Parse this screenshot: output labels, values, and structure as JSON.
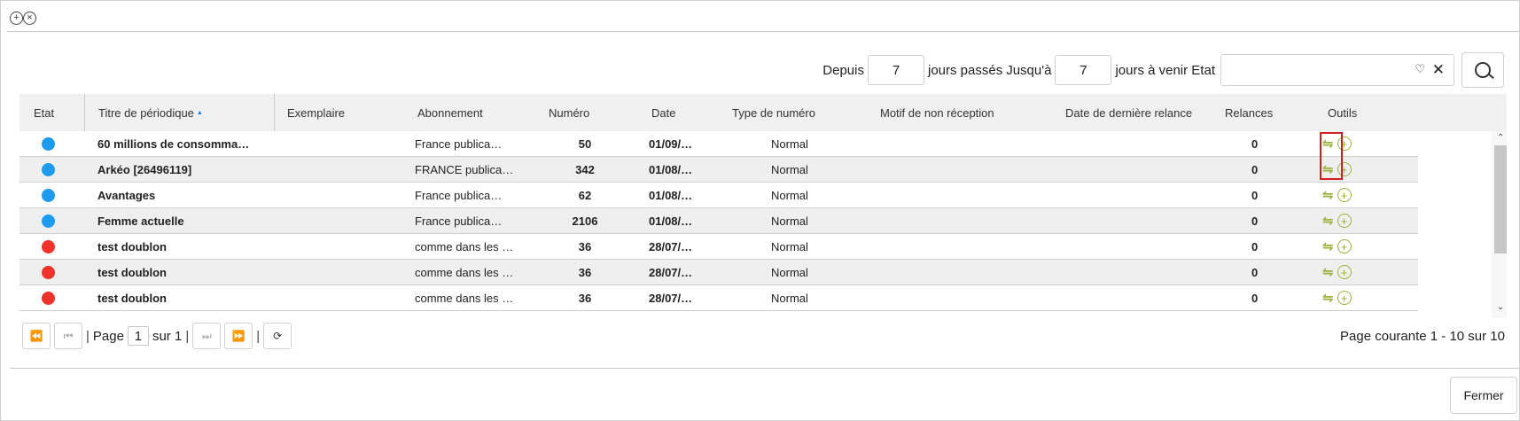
{
  "filters": {
    "since_label": "Depuis",
    "since_value": "7",
    "past_days_label": "jours passés",
    "until_label": "Jusqu'à",
    "until_value": "7",
    "future_days_label": "jours à venir Etat",
    "state_value": ""
  },
  "table": {
    "headers": {
      "etat": "Etat",
      "titre": "Titre de périodique",
      "exemplaire": "Exemplaire",
      "abonnement": "Abonnement",
      "numero": "Numéro",
      "date": "Date",
      "type": "Type de numéro",
      "motif": "Motif de non réception",
      "derniere_relance": "Date de dernière relance",
      "relances": "Relances",
      "outils": "Outils"
    },
    "rows": [
      {
        "color": "#1e9bef",
        "titre": "60 millions de consomma…",
        "abonnement": "France     publica…",
        "numero": "50",
        "date": "01/09/…",
        "type": "Normal",
        "relances": "0"
      },
      {
        "color": "#1e9bef",
        "titre": "Arkéo [26496119]",
        "abonnement": "FRANCE  publica…",
        "numero": "342",
        "date": "01/08/…",
        "type": "Normal",
        "relances": "0"
      },
      {
        "color": "#1e9bef",
        "titre": "Avantages",
        "abonnement": "France     publica…",
        "numero": "62",
        "date": "01/08/…",
        "type": "Normal",
        "relances": "0"
      },
      {
        "color": "#1e9bef",
        "titre": "Femme actuelle",
        "abonnement": "France     publica…",
        "numero": "2106",
        "date": "01/08/…",
        "type": "Normal",
        "relances": "0"
      },
      {
        "color": "#f0322a",
        "titre": "test doublon",
        "abonnement": "comme dans les …",
        "numero": "36",
        "date": "28/07/…",
        "type": "Normal",
        "relances": "0"
      },
      {
        "color": "#f0322a",
        "titre": "test doublon",
        "abonnement": "comme dans les …",
        "numero": "36",
        "date": "28/07/…",
        "type": "Normal",
        "relances": "0"
      },
      {
        "color": "#f0322a",
        "titre": "test doublon",
        "abonnement": "comme dans les …",
        "numero": "36",
        "date": "28/07/…",
        "type": "Normal",
        "relances": "0"
      }
    ]
  },
  "pager": {
    "page_label": "Page",
    "page_value": "1",
    "of_label": "sur 1",
    "info": "Page courante 1 - 10 sur 10"
  },
  "footer": {
    "close_label": "Fermer"
  },
  "icons": {
    "tool_swap": "swap-arrows-icon",
    "tool_add": "add-circle-icon"
  }
}
